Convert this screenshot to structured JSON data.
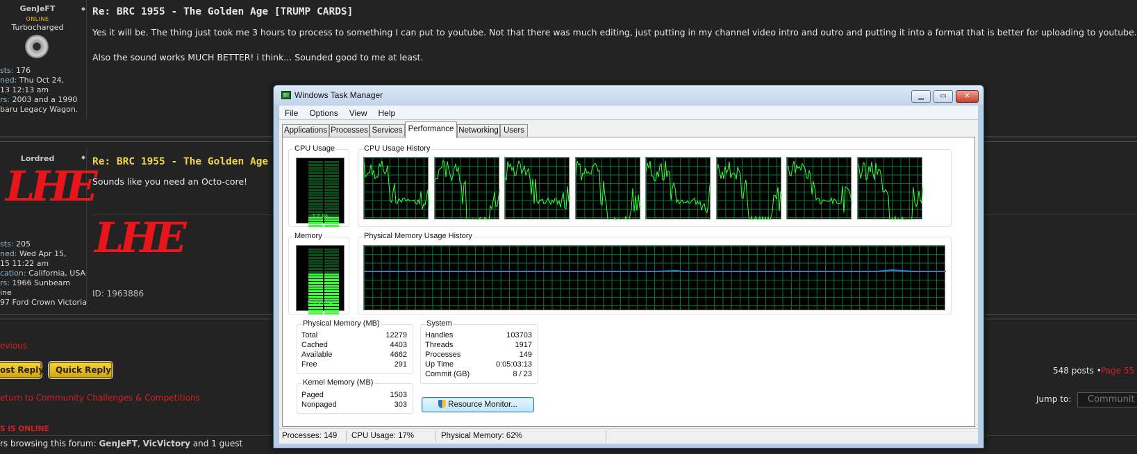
{
  "forum": {
    "post1": {
      "username": "GenJeFT",
      "online": "ONLINE",
      "rank": "Turbocharged",
      "posts_label": "sts:",
      "posts_value": "176",
      "joined_label": "ned:",
      "joined_value": "Thu Oct 24,",
      "joined_value2": "13 12:13 am",
      "cars_label": "rs:",
      "cars_value": "2003 and a 1990",
      "cars_value2": "baru Legacy Wagon.",
      "title": "Re: BRC 1955 - The Golden Age [TRUMP CARDS]",
      "text1": "Yes it will be. The thing just took me 3 hours to process to something I can put to youtube. Not that there was much editing, just putting in my channel video intro and outro and putting it into a format that is better for uploading to youtube.",
      "text2": "Also the sound works MUCH BETTER! i think... Sounded good to me at least."
    },
    "post2": {
      "username": "Lordred",
      "logo_text": "LHE",
      "posts_label": "sts:",
      "posts_value": "205",
      "joined_label": "ned:",
      "joined_value": "Wed Apr 15,",
      "joined_value2": "15 11:22 am",
      "location_label": "cation:",
      "location_value": "California, USA",
      "cars_label": "rs:",
      "cars_value": "1966 Sunbeam",
      "cars_value2": "ine",
      "cars_value3": "97 Ford Crown Victoria",
      "title": "Re: BRC 1955 - The Golden Age [TRU",
      "text1": "Sounds like you need an Octo-core!",
      "sig_id": "ID: 1963886"
    },
    "previous": "evious",
    "post_reply": "ost Reply",
    "quick_reply": "Quick Reply",
    "return_link": "eturn to Community Challenges & Competitions",
    "posts_count": "548 posts •",
    "page_label": "Page 55",
    "jump_to": "Jump to:",
    "jump_value": "Communit",
    "who_online": "S IS ONLINE",
    "browsing_prefix": "rs browsing this forum:",
    "browsing_user1": "GenJeFT",
    "browsing_sep": ",",
    "browsing_user2": "VicVictory",
    "browsing_suffix": "and 1 guest"
  },
  "taskmgr": {
    "title": "Windows Task Manager",
    "menu": [
      "File",
      "Options",
      "View",
      "Help"
    ],
    "tabs": [
      "Applications",
      "Processes",
      "Services",
      "Performance",
      "Networking",
      "Users"
    ],
    "active_tab": "Performance",
    "cpu_usage_label": "CPU Usage",
    "cpu_usage_value": "17 %",
    "cpu_usage_fraction": 0.17,
    "cpu_history_label": "CPU Usage History",
    "memory_label": "Memory",
    "memory_value": "7.43 GB",
    "memory_fraction": 0.62,
    "phys_history_label": "Physical Memory Usage History",
    "physical_memory": {
      "label": "Physical Memory (MB)",
      "rows": [
        {
          "k": "Total",
          "v": "12279"
        },
        {
          "k": "Cached",
          "v": "4403"
        },
        {
          "k": "Available",
          "v": "4662"
        },
        {
          "k": "Free",
          "v": "291"
        }
      ]
    },
    "kernel_memory": {
      "label": "Kernel Memory (MB)",
      "rows": [
        {
          "k": "Paged",
          "v": "1503"
        },
        {
          "k": "Nonpaged",
          "v": "303"
        }
      ]
    },
    "system": {
      "label": "System",
      "rows": [
        {
          "k": "Handles",
          "v": "103703"
        },
        {
          "k": "Threads",
          "v": "1917"
        },
        {
          "k": "Processes",
          "v": "149"
        },
        {
          "k": "Up Time",
          "v": "0:05:03:13"
        },
        {
          "k": "Commit (GB)",
          "v": "8 / 23"
        }
      ]
    },
    "resource_monitor_button": "Resource Monitor...",
    "status": {
      "processes": "Processes: 149",
      "cpu": "CPU Usage: 17%",
      "memory": "Physical Memory: 62%"
    },
    "colors": {
      "graph_line": "#39ff39",
      "grid": "#0a7a3a",
      "memory_line": "#2a7fe0"
    }
  }
}
